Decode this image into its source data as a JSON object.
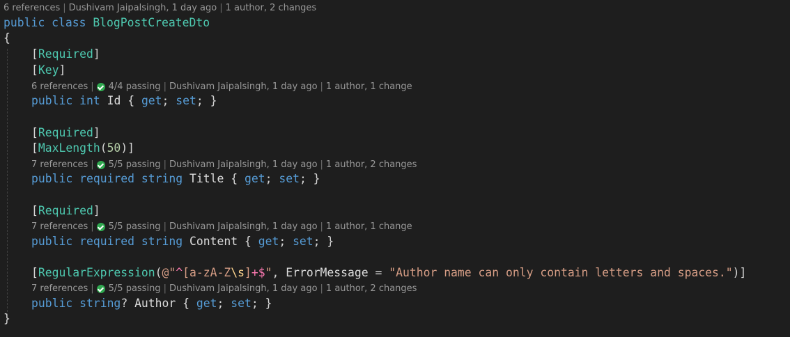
{
  "class_lens": {
    "references": "6 references",
    "author": "Dushivam Jaipalsingh, 1 day ago",
    "changes": "1 author, 2 changes"
  },
  "class_decl": {
    "kw_public": "public",
    "kw_class": "class",
    "name": "BlogPostCreateDto"
  },
  "braces": {
    "open": "{",
    "close": "}"
  },
  "id_prop": {
    "attr1": "Required",
    "attr2": "Key",
    "lens": {
      "references": "6 references",
      "tests": "4/4 passing",
      "author": "Dushivam Jaipalsingh, 1 day ago",
      "changes": "1 author, 1 change"
    },
    "kw_public": "public",
    "type": "int",
    "name": "Id",
    "get": "get",
    "set": "set"
  },
  "title_prop": {
    "attr1": "Required",
    "attr2": "MaxLength",
    "attr2_arg": "50",
    "lens": {
      "references": "7 references",
      "tests": "5/5 passing",
      "author": "Dushivam Jaipalsingh, 1 day ago",
      "changes": "1 author, 2 changes"
    },
    "kw_public": "public",
    "kw_required": "required",
    "type": "string",
    "name": "Title",
    "get": "get",
    "set": "set"
  },
  "content_prop": {
    "attr1": "Required",
    "lens": {
      "references": "7 references",
      "tests": "5/5 passing",
      "author": "Dushivam Jaipalsingh, 1 day ago",
      "changes": "1 author, 1 change"
    },
    "kw_public": "public",
    "kw_required": "required",
    "type": "string",
    "name": "Content",
    "get": "get",
    "set": "set"
  },
  "author_prop": {
    "attr": "RegularExpression",
    "regex_prefix": "@\"",
    "regex_caret": "^",
    "regex_class_open": "[a-zA-Z",
    "regex_escape": "\\s",
    "regex_class_close": "]",
    "regex_quant": "+$",
    "regex_suffix": "\"",
    "param_name": "ErrorMessage",
    "message": "\"Author name can only contain letters and spaces.\"",
    "lens": {
      "references": "7 references",
      "tests": "5/5 passing",
      "author": "Dushivam Jaipalsingh, 1 day ago",
      "changes": "1 author, 2 changes"
    },
    "kw_public": "public",
    "type": "string",
    "name": "Author",
    "get": "get",
    "set": "set"
  }
}
